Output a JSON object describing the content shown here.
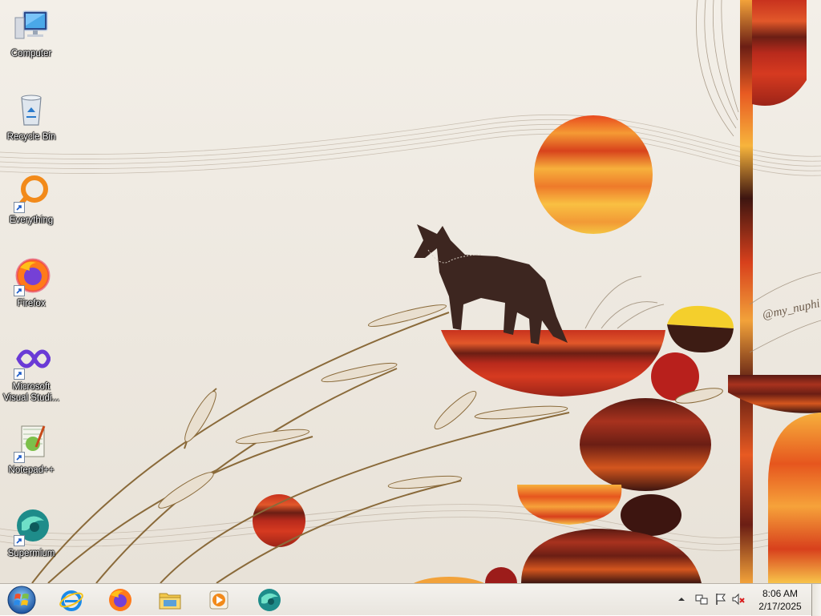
{
  "desktop": {
    "icons": [
      {
        "label": "Computer",
        "icon": "computer-icon",
        "shortcut": false
      },
      {
        "label": "Recycle Bin",
        "icon": "recycle-bin-icon",
        "shortcut": false
      },
      {
        "label": "Everything",
        "icon": "everything-icon",
        "shortcut": true
      },
      {
        "label": "Firefox",
        "icon": "firefox-icon",
        "shortcut": true
      },
      {
        "label": "Microsoft Visual Studi...",
        "icon": "visual-studio-icon",
        "shortcut": true
      },
      {
        "label": "Notepad++",
        "icon": "notepad-plus-plus-icon",
        "shortcut": true
      },
      {
        "label": "Supermium",
        "icon": "supermium-icon",
        "shortcut": true
      }
    ],
    "wallpaper": {
      "signature": "@my_nuphi",
      "palette": [
        "#f2a23a",
        "#c8321e",
        "#6b1e14",
        "#f4cf2c",
        "#3d2620"
      ]
    }
  },
  "taskbar": {
    "start": {
      "icon": "windows-start-orb-icon"
    },
    "pinned": [
      {
        "name": "Internet Explorer",
        "icon": "internet-explorer-icon"
      },
      {
        "name": "Firefox",
        "icon": "firefox-icon"
      },
      {
        "name": "File Explorer",
        "icon": "folder-icon"
      },
      {
        "name": "Media Player",
        "icon": "media-player-icon"
      },
      {
        "name": "Supermium",
        "icon": "supermium-icon"
      }
    ],
    "tray": {
      "icons": [
        "show-hidden-icons-chevron",
        "network-icon",
        "action-center-flag-icon",
        "volume-muted-icon"
      ],
      "time": "8:06 AM",
      "date": "2/17/2025"
    }
  }
}
